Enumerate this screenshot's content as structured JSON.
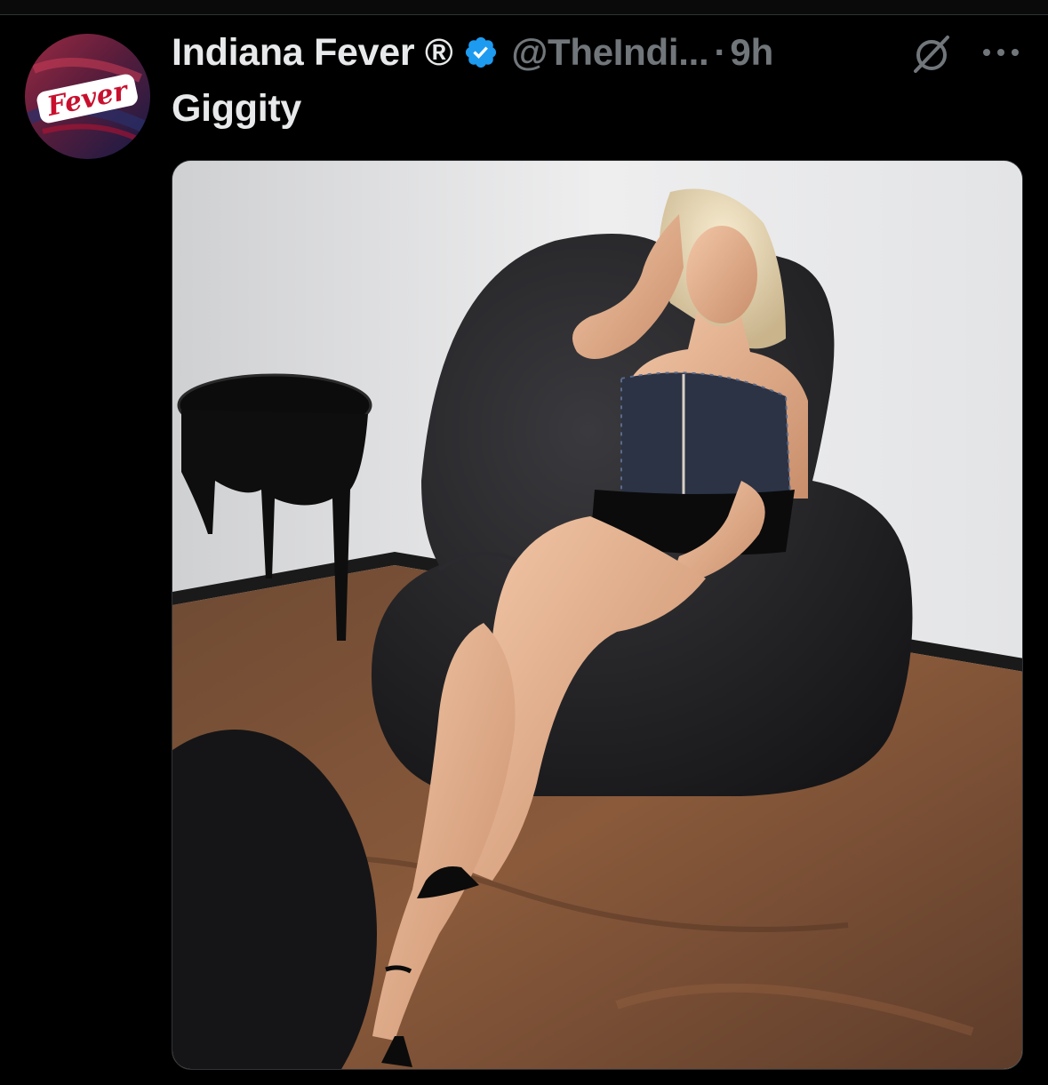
{
  "tweet": {
    "author": {
      "display_name": "Indiana Fever ®",
      "handle": "@TheIndi...",
      "verified": true,
      "avatar_logo_text": "Fever"
    },
    "separator": "·",
    "timestamp": "9h",
    "text": "Giggity",
    "actions": {
      "grok_icon": "grok-icon",
      "more_icon": "more-icon"
    },
    "media": {
      "type": "photo"
    }
  },
  "colors": {
    "background": "#000000",
    "primary_text": "#e7e9ea",
    "secondary_text": "#71767b",
    "verified_blue": "#1d9bf0",
    "avatar_red": "#c8102e",
    "avatar_navy": "#1b1f4a"
  }
}
